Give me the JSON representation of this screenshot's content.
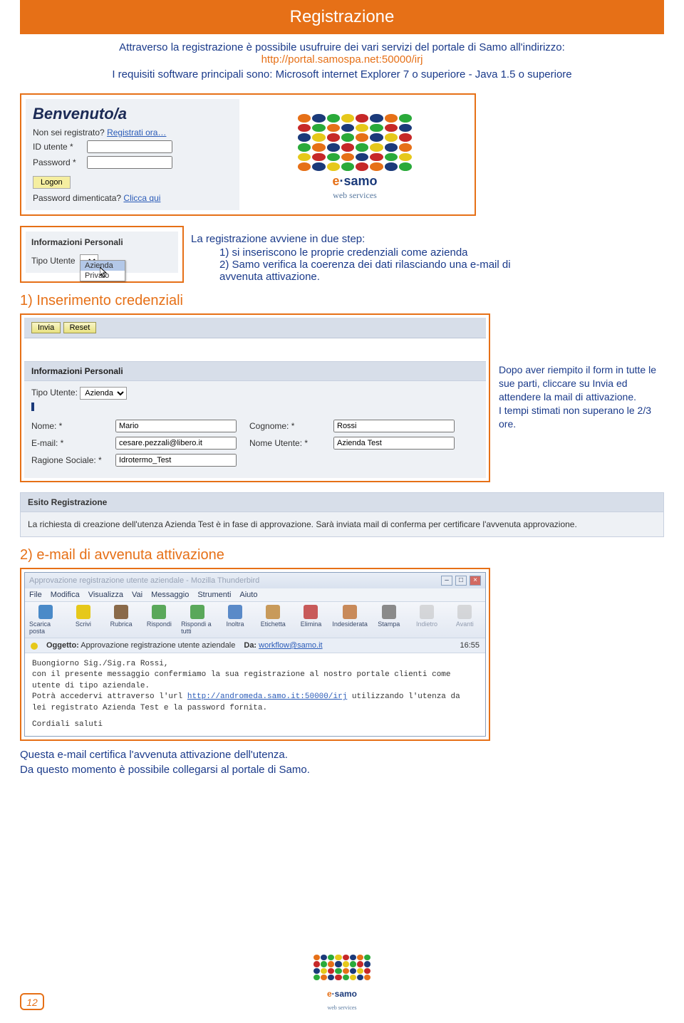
{
  "page_title": "Registrazione",
  "intro_line1": "Attraverso la registrazione è possibile usufruire dei vari servizi del portale di Samo all'indirizzo:",
  "intro_url": "http://portal.samospa.net:50000/irj",
  "req_line": "I requisiti software principali sono: Microsoft internet Explorer 7 o superiore - Java 1.5 o superiore",
  "benvenuto": {
    "title": "Benvenuto/a",
    "not_registered_q": "Non sei registrato?",
    "register_now": "Registrati ora…",
    "user_label": "ID utente *",
    "pass_label": "Password *",
    "logon_btn": "Logon",
    "forgot_q": "Password dimenticata?",
    "click_here": "Clicca qui"
  },
  "brand": {
    "e": "e",
    "dot": "·",
    "name": "samo",
    "sub": "web services"
  },
  "ip1": {
    "hdr": "Informazioni Personali",
    "tipo_label": "Tipo Utente",
    "options": [
      "Azienda",
      "Privato"
    ],
    "selected": "Azienda"
  },
  "steps": {
    "lead": "La registrazione avviene in due step:",
    "s1": "1) si inseriscono le proprie credenziali come azienda",
    "s2": "2) Samo verifica la coerenza dei dati rilasciando una e-mail di",
    "s2b": "avvenuta attivazione."
  },
  "section1": "1) Inserimento credenziali",
  "cred": {
    "invia": "Invia",
    "reset": "Reset",
    "hdr": "Informazioni Personali",
    "tipo_label": "Tipo Utente:",
    "tipo_val": "Azienda",
    "nome_label": "Nome: *",
    "nome_val": "Mario",
    "cognome_label": "Cognome: *",
    "cognome_val": "Rossi",
    "email_label": "E-mail: *",
    "email_val": "cesare.pezzali@libero.it",
    "nomeutente_label": "Nome Utente: *",
    "nomeutente_val": "Azienda Test",
    "ragione_label": "Ragione Sociale: *",
    "ragione_val": "Idrotermo_Test",
    "note1": "Dopo aver riempito il form in tutte le sue parti, cliccare su Invia ed attendere la mail di attivazione.",
    "note2": "I tempi stimati non superano le 2/3 ore."
  },
  "esito": {
    "hdr": "Esito Registrazione",
    "body": "La richiesta di creazione dell'utenza Azienda Test è in fase di approvazione. Sarà inviata mail di conferma per certificare l'avvenuta approvazione."
  },
  "section2": "2) e-mail di avvenuta attivazione",
  "email": {
    "title": "Approvazione registrazione utente aziendale - Mozilla Thunderbird",
    "menu": [
      "File",
      "Modifica",
      "Visualizza",
      "Vai",
      "Messaggio",
      "Strumenti",
      "Aiuto"
    ],
    "toolbar": [
      "Scarica posta",
      "Scrivi",
      "Rubrica",
      "Rispondi",
      "Rispondi a tutti",
      "Inoltra",
      "Etichetta",
      "Elimina",
      "Indesiderata",
      "Stampa",
      "Indietro",
      "Avanti"
    ],
    "subject_label": "Oggetto:",
    "subject": "Approvazione registrazione utente aziendale",
    "from_label": "Da:",
    "from": "workflow@samo.it",
    "time": "16:55",
    "body1": "Buongiorno Sig./Sig.ra Rossi,",
    "body2": "con il presente messaggio confermiamo la sua registrazione al nostro portale clienti come utente di tipo aziendale.",
    "body3a": "Potrà accedervi attraverso l'url ",
    "body3url": "http://andromeda.samo.it:50000/irj",
    "body3b": " utilizzando l'utenza da lei registrato Azienda Test e la password fornita.",
    "body4": "Cordiali saluti"
  },
  "after_email_1": "Questa e-mail certifica l'avvenuta attivazione dell'utenza.",
  "after_email_2": "Da questo momento è possibile collegarsi al portale di Samo.",
  "pagenum": "12"
}
